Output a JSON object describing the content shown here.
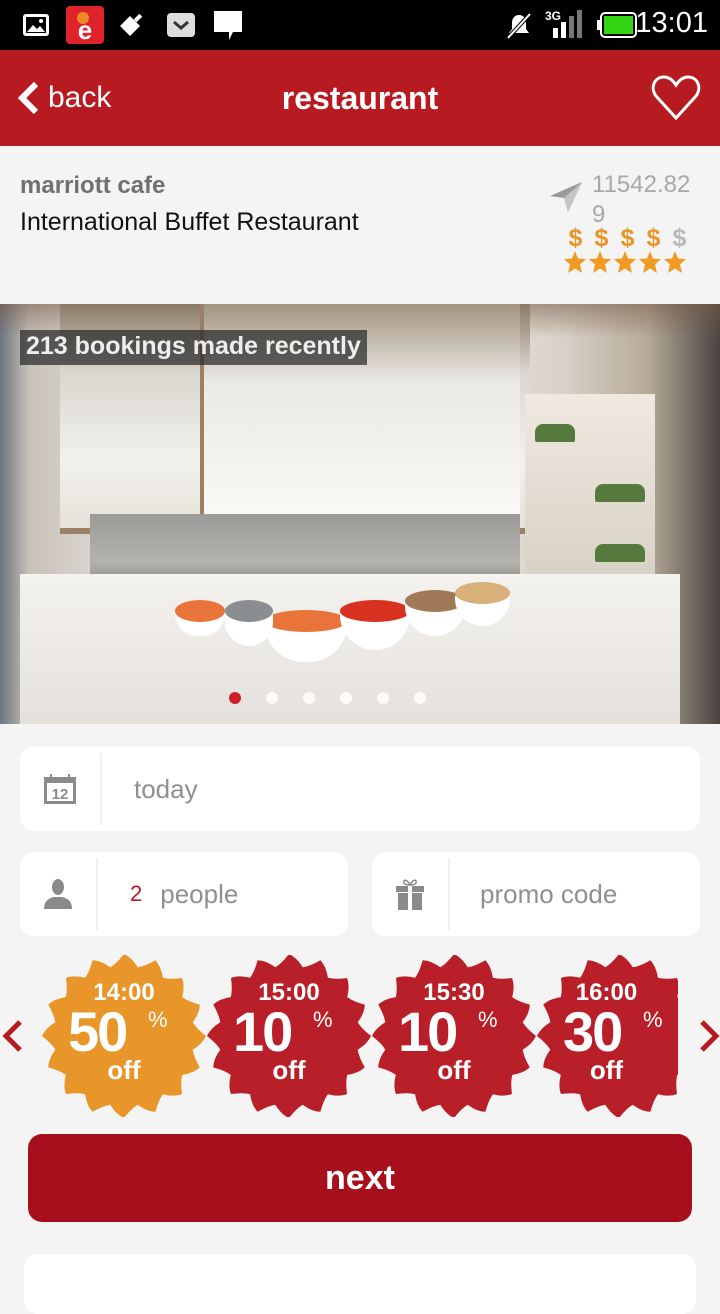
{
  "status_bar": {
    "time": "13:01",
    "network": "3G",
    "left_icons": [
      "gallery-icon",
      "app-e-icon",
      "usb-debug-icon",
      "mail-icon",
      "message-icon"
    ],
    "right_icons": [
      "mute-icon",
      "signal-3g-icon",
      "battery-icon"
    ]
  },
  "app_bar": {
    "back_label": "back",
    "title": "restaurant",
    "favorite_icon": "heart-outline-icon"
  },
  "restaurant": {
    "name": "marriott cafe",
    "type": "International Buffet Restaurant",
    "distance": "11542.829",
    "price_level": 4,
    "price_max": 5,
    "price_symbol": "$",
    "rating": 5,
    "rating_max": 5
  },
  "gallery": {
    "overlay_text": "213 bookings made recently",
    "slide_count": 6,
    "active_slide": 1
  },
  "form": {
    "date": {
      "icon": "calendar-icon",
      "icon_text": "12",
      "value": "today"
    },
    "people": {
      "icon": "person-icon",
      "count": "2",
      "label": "people"
    },
    "promo": {
      "icon": "gift-icon",
      "placeholder": "promo code"
    }
  },
  "deals": [
    {
      "time": "14:00",
      "discount": "50",
      "percent": "%",
      "off": "off",
      "selected": true,
      "color": "#e8952a"
    },
    {
      "time": "15:00",
      "discount": "10",
      "percent": "%",
      "off": "off",
      "selected": false,
      "color": "#b81f28"
    },
    {
      "time": "15:30",
      "discount": "10",
      "percent": "%",
      "off": "off",
      "selected": false,
      "color": "#b81f28"
    },
    {
      "time": "16:00",
      "discount": "30",
      "percent": "%",
      "off": "off",
      "selected": false,
      "color": "#b81f28"
    }
  ],
  "deal_nav": {
    "prev_icon": "chevron-left-icon",
    "next_icon": "chevron-right-icon"
  },
  "actions": {
    "next_label": "next"
  },
  "colors": {
    "brand": "#b81a21",
    "button": "#a80f1d",
    "accent": "#e8952a",
    "muted": "#8f8f8f"
  }
}
